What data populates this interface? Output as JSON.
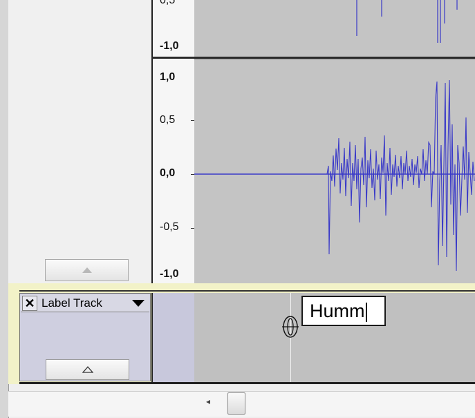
{
  "audio_track": {
    "ruler_labels": {
      "prev_top": "0,5",
      "prev_bottom": "-1,0",
      "top": "1,0",
      "upper": "0,5",
      "middle": "0,0",
      "lower": "-0,5",
      "bottom": "-1,0"
    },
    "waveform_color": "#3a3ac8"
  },
  "label_track": {
    "close_glyph": "✕",
    "name": "Label Track",
    "label_text": "Humm"
  },
  "icons": [
    "close-icon",
    "dropdown-arrow-icon",
    "collapse-arrow-icon",
    "label-anchor-icon",
    "scroll-left-icon"
  ]
}
